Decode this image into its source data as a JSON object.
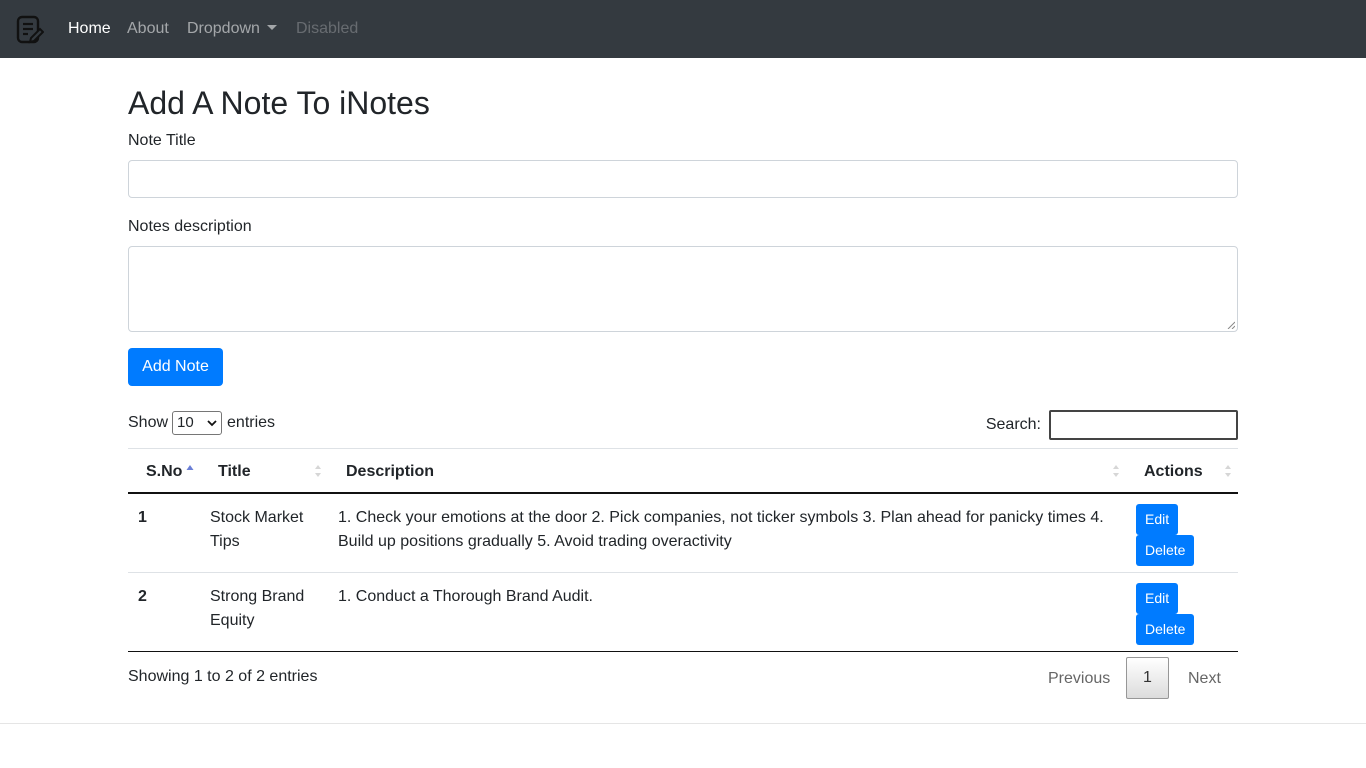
{
  "navbar": {
    "links": [
      {
        "label": "Home",
        "state": "active"
      },
      {
        "label": "About",
        "state": "normal"
      },
      {
        "label": "Dropdown",
        "state": "normal"
      },
      {
        "label": "Disabled",
        "state": "disabled"
      }
    ],
    "brand_icon": "notes-edit-icon"
  },
  "form": {
    "heading": "Add A Note To iNotes",
    "title_label": "Note Title",
    "title_value": "",
    "desc_label": "Notes description",
    "desc_value": "",
    "submit_label": "Add Note"
  },
  "table_controls": {
    "show_label": "Show",
    "page_length": "10",
    "entries_label": "entries",
    "search_label": "Search:",
    "search_value": ""
  },
  "table": {
    "columns": [
      "S.No",
      "Title",
      "Description",
      "Actions"
    ],
    "sorted_column": "S.No",
    "rows": [
      {
        "sno": "1",
        "title": "Stock Market Tips",
        "description": "1. Check your emotions at the door 2. Pick companies, not ticker symbols 3. Plan ahead for panicky times 4. Build up positions gradually 5. Avoid trading overactivity",
        "edit_label": "Edit",
        "delete_label": "Delete"
      },
      {
        "sno": "2",
        "title": "Strong Brand Equity",
        "description": "1. Conduct a Thorough Brand Audit.",
        "edit_label": "Edit",
        "delete_label": "Delete"
      }
    ]
  },
  "pagination": {
    "info": "Showing 1 to 2 of 2 entries",
    "previous_label": "Previous",
    "current_page": "1",
    "next_label": "Next"
  },
  "colors": {
    "navbar_bg": "#343a40",
    "primary": "#007bff"
  }
}
